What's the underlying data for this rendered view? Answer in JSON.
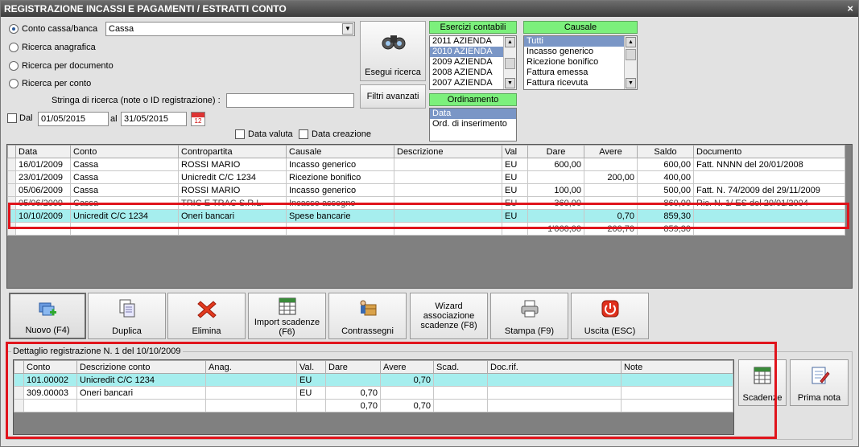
{
  "window": {
    "title": "REGISTRAZIONE INCASSI E PAGAMENTI / ESTRATTI CONTO",
    "close": "×"
  },
  "search": {
    "radio_options": [
      "Conto cassa/banca",
      "Ricerca anagrafica",
      "Ricerca per documento",
      "Ricerca per conto"
    ],
    "selected_index": 0,
    "account_value": "Cassa",
    "search_string_label": "Stringa di ricerca (note o ID registrazione) :",
    "search_string_value": "",
    "dal_label": "Dal",
    "date_from": "01/05/2015",
    "al_label": "al",
    "date_to": "31/05/2015",
    "data_valuta_label": "Data valuta",
    "data_creazione_label": "Data creazione",
    "calendar_label": "12"
  },
  "buttons": {
    "esegui_ricerca": "Esegui ricerca",
    "filtri_avanzati": "Filtri avanzati"
  },
  "esercizi": {
    "header": "Esercizi contabili",
    "items": [
      "2011 AZIENDA",
      "2010 AZIENDA",
      "2009 AZIENDA",
      "2008 AZIENDA",
      "2007 AZIENDA"
    ],
    "selected_index": 1
  },
  "causale": {
    "header": "Causale",
    "items": [
      "Tutti",
      "Incasso generico",
      "Ricezione bonifico",
      "Fattura emessa",
      "Fattura ricevuta"
    ],
    "selected_index": 0
  },
  "ordinamento": {
    "header": "Ordinamento",
    "items": [
      "Data",
      "Ord. di inserimento"
    ],
    "selected_index": 0
  },
  "main_table": {
    "columns": [
      "Data",
      "Conto",
      "Contropartita",
      "Causale",
      "Descrizione",
      "Val",
      "Dare",
      "Avere",
      "Saldo",
      "Documento"
    ],
    "rows": [
      [
        "16/01/2009",
        "Cassa",
        "ROSSI MARIO",
        "Incasso generico",
        "",
        "EU",
        "600,00",
        "",
        "600,00",
        "Fatt. NNNN del 20/01/2008"
      ],
      [
        "23/01/2009",
        "Cassa",
        "Unicredit C/C 1234",
        "Ricezione bonifico",
        "",
        "EU",
        "",
        "200,00",
        "400,00",
        ""
      ],
      [
        "05/06/2009",
        "Cassa",
        "ROSSI MARIO",
        "Incasso generico",
        "",
        "EU",
        "100,00",
        "",
        "500,00",
        "Fatt. N. 74/2009 del 29/11/2009"
      ],
      [
        "05/06/2009",
        "Cassa",
        "TRIC E TRAC S.R.L.",
        "Incasso assegno",
        "",
        "EU",
        "360,00",
        "",
        "860,00",
        "Ric. N. 1/ ES del 20/01/2004"
      ],
      [
        "10/10/2009",
        "Unicredit C/C 1234",
        "Oneri bancari",
        "Spese bancarie",
        "",
        "EU",
        "",
        "0,70",
        "859,30",
        ""
      ]
    ],
    "totals": [
      "",
      "",
      "",
      "",
      "",
      "",
      "1'060,00",
      "200,70",
      "859,30",
      ""
    ],
    "highlighted_row": 4
  },
  "toolbar": {
    "nuovo": "Nuovo (F4)",
    "duplica": "Duplica",
    "elimina": "Elimina",
    "import_scadenze": "Import scadenze (F6)",
    "contrassegni": "Contrassegni",
    "wizard": "Wizard associazione scadenze (F8)",
    "stampa": "Stampa (F9)",
    "uscita": "Uscita (ESC)"
  },
  "detail": {
    "legend": "Dettaglio registrazione N. 1 del 10/10/2009",
    "columns": [
      "Conto",
      "Descrizione conto",
      "Anag.",
      "Val.",
      "Dare",
      "Avere",
      "Scad.",
      "Doc.rif.",
      "Note"
    ],
    "rows": [
      [
        "101.00002",
        "Unicredit C/C 1234",
        "",
        "EU",
        "",
        "0,70",
        "",
        "",
        ""
      ],
      [
        "309.00003",
        "Oneri bancari",
        "",
        "EU",
        "0,70",
        "",
        "",
        "",
        ""
      ]
    ],
    "totals": [
      "",
      "",
      "",
      "",
      "0,70",
      "0,70",
      "",
      "",
      ""
    ],
    "highlighted_row": 0,
    "scadenze_button": "Scadenze",
    "prima_nota_button": "Prima nota"
  }
}
